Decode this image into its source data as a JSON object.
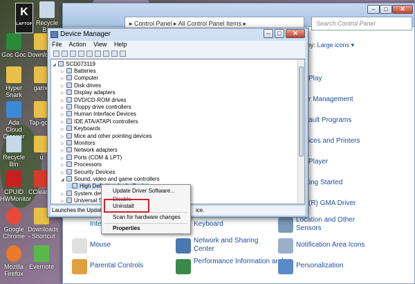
{
  "brand": {
    "letter": "K",
    "text": "LAPTOP"
  },
  "desktop_icons": [
    {
      "label": "Recycle Bin"
    },
    {
      "label": "Goc Goc"
    },
    {
      "label": "Downloads"
    },
    {
      "label": "Hyper Snark"
    },
    {
      "label": "game"
    },
    {
      "label": "Ada Cloud Cleaner"
    },
    {
      "label": "Tap-go-T"
    },
    {
      "label": "Recycle Bin"
    },
    {
      "label": "u"
    },
    {
      "label": "CPUID HWMonitor"
    },
    {
      "label": "CCleaner"
    },
    {
      "label": "Google Chrome"
    },
    {
      "label": "Downloads - Shortcut"
    },
    {
      "label": "Mozilla Firefox"
    },
    {
      "label": "Evernote"
    }
  ],
  "control_panel": {
    "address": "▸ Control Panel ▸ All Control Panel Items ▸",
    "search_placeholder": "Search Control Panel",
    "view_label": "View by:",
    "view_value": "Large icons ▾",
    "items": [
      {
        "label": "Play"
      },
      {
        "label": "r Management"
      },
      {
        "label": "ault Programs"
      },
      {
        "label": "ices and Printers"
      },
      {
        "label": "Player"
      },
      {
        "label": "Getting Started"
      },
      {
        "label": "(R) GMA Driver"
      },
      {
        "label": "Intel"
      },
      {
        "label": "Keyboard"
      },
      {
        "label": "Location and Other Sensors"
      },
      {
        "label": "Mouse"
      },
      {
        "label": "Network and Sharing Center"
      },
      {
        "label": "Notification Area Icons"
      },
      {
        "label": "Parental Controls"
      },
      {
        "label": "Performance Information and"
      },
      {
        "label": "Personalization"
      }
    ]
  },
  "device_manager": {
    "title": "Device Manager",
    "menu": [
      "File",
      "Action",
      "View",
      "Help"
    ],
    "root": "SCD073119",
    "tree": [
      "Batteries",
      "Computer",
      "Disk drives",
      "Display adapters",
      "DVD/CD-ROM drives",
      "Floppy drive controllers",
      "Human Interface Devices",
      "IDE ATA/ATAPI controllers",
      "Keyboards",
      "Mice and other pointing devices",
      "Monitors",
      "Network adapters",
      "Ports (COM & LPT)",
      "Processors",
      "Security Devices",
      "Sound, video and game controllers",
      "High Definition Audio Device",
      "System devi",
      "Universal Se"
    ],
    "status": "Launches the Update D",
    "status_tail": "ice."
  },
  "context_menu": {
    "items": [
      "Update Driver Software...",
      "Disable",
      "Uninstall",
      "Scan for hardware changes",
      "Properties"
    ]
  }
}
